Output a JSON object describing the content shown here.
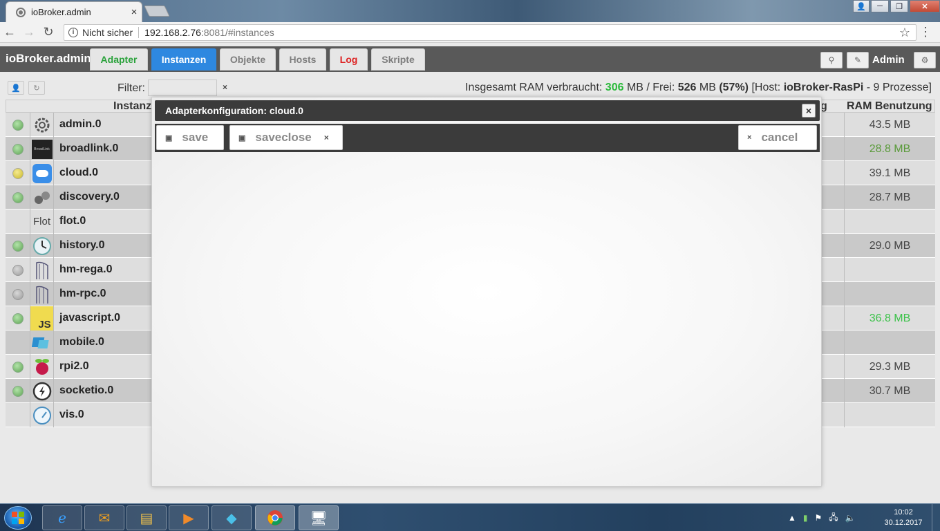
{
  "browser": {
    "tab_title": "ioBroker.admin",
    "tab_close": "×",
    "security_label": "Nicht sicher",
    "url_host": "192.168.2.76",
    "url_rest": ":8081/#instances",
    "nav_back": "←",
    "nav_forward": "→",
    "nav_reload": "↻",
    "bookmark": "☆",
    "menu": "⋮"
  },
  "window_controls": {
    "minimize": "─",
    "maximize": "❐",
    "close": "✕"
  },
  "app": {
    "brand": "ioBroker.admin",
    "tabs": [
      {
        "label": "Adapter"
      },
      {
        "label": "Instanzen"
      },
      {
        "label": "Objekte"
      },
      {
        "label": "Hosts"
      },
      {
        "label": "Log"
      },
      {
        "label": "Skripte"
      }
    ],
    "user_label": "Admin"
  },
  "subbar": {
    "filter_label": "Filter:",
    "filter_value": "",
    "clear": "×",
    "ram": {
      "prefix": "Insgesamt RAM verbraucht: ",
      "used": "306",
      "mid": " MB / Frei: ",
      "free": "526",
      "unit": " MB ",
      "percent": "(57%)",
      "host_prefix": " [Host: ",
      "host": "ioBroker-RasPi",
      "suffix": " - 9 Prozesse]"
    }
  },
  "grid": {
    "col_instanz": "Instanz",
    "col_partial": "g",
    "col_ram": "RAM Benutzung",
    "rows": [
      {
        "name": "admin.0",
        "led": "green",
        "ram": "43.5 MB"
      },
      {
        "name": "broadlink.0",
        "led": "green",
        "ram": "28.8 MB",
        "ram_color": "olive"
      },
      {
        "name": "cloud.0",
        "led": "yellow",
        "ram": "39.1 MB"
      },
      {
        "name": "discovery.0",
        "led": "green",
        "ram": "28.7 MB"
      },
      {
        "name": "flot.0",
        "led": "none",
        "ram": "",
        "icon_text": "Flot"
      },
      {
        "name": "history.0",
        "led": "green",
        "ram": "29.0 MB"
      },
      {
        "name": "hm-rega.0",
        "led": "grey",
        "ram": ""
      },
      {
        "name": "hm-rpc.0",
        "led": "grey",
        "ram": ""
      },
      {
        "name": "javascript.0",
        "led": "green",
        "ram": "36.8 MB",
        "ram_color": "green",
        "icon_text": "JS"
      },
      {
        "name": "mobile.0",
        "led": "none",
        "ram": ""
      },
      {
        "name": "rpi2.0",
        "led": "green",
        "ram": "29.3 MB"
      },
      {
        "name": "socketio.0",
        "led": "green",
        "ram": "30.7 MB"
      },
      {
        "name": "vis.0",
        "led": "none",
        "ram": ""
      }
    ]
  },
  "dialog": {
    "title": "Adapterkonfiguration: cloud.0",
    "close": "×",
    "save_label": "save",
    "saveclose_label": "saveclose",
    "saveclose_x": "×",
    "cancel_icon": "×",
    "cancel_label": "cancel"
  },
  "taskbar": {
    "time": "10:02",
    "date": "30.12.2017"
  },
  "colors": {
    "accent_blue": "#2e88e0",
    "adapter_green": "#2aa23b",
    "log_red": "#dd2222",
    "ram_green": "#2ab93a"
  }
}
